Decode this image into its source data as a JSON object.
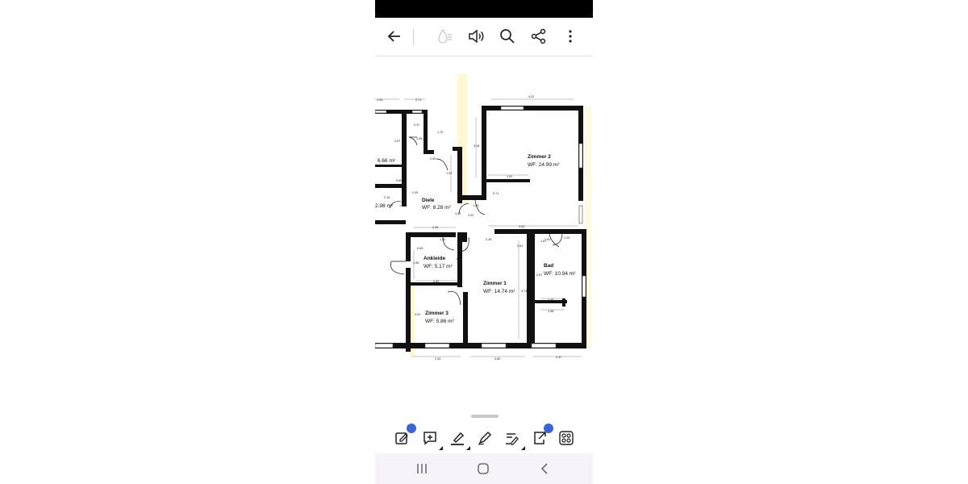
{
  "toolbar": {
    "icons": [
      "back-arrow-icon",
      "water-drop-icon",
      "speaker-icon",
      "search-icon",
      "share-icon",
      "more-vert-icon"
    ]
  },
  "floorplan": {
    "rooms": [
      {
        "name": "Zimmer 2",
        "area": "WF: 24.99 m²"
      },
      {
        "name": "Diele",
        "area": "WF: 8.28 m²"
      },
      {
        "name": "Ankleide",
        "area": "WF: 5.17 m²"
      },
      {
        "name": "Zimmer 1",
        "area": "WF: 14.74 m²"
      },
      {
        "name": "Bad",
        "area": "WF: 10.94 m²"
      },
      {
        "name": "Zimmer 3",
        "area": "WF: 5.86 m²"
      }
    ],
    "partial_rooms": [
      {
        "area": "6.66 m²"
      },
      {
        "area": "2.98 m²"
      }
    ],
    "dimensions": [
      "4.22",
      "1.94",
      "0.71",
      "0.37",
      "1.70",
      "2.67",
      "1.45",
      "WC",
      "2.05",
      "1.87",
      "0.69",
      "2.16",
      "2.39",
      "1.25",
      "1.52",
      "0.71",
      "3.18",
      "1.29",
      "1.02",
      "1.27",
      "2.30",
      "1.50",
      "2.36",
      "0.61",
      "0.69",
      "1.00",
      "1.67",
      "1.55",
      "2.67",
      "1.45",
      "1.56",
      "4.74",
      "2.32",
      "1.36",
      "2.51",
      "2.33",
      "3.80",
      "2.37",
      "2.91",
      "3.52"
    ]
  },
  "bottom_toolbar": {
    "icons": [
      "edit-document-icon",
      "add-comment-icon",
      "highlighter-icon",
      "pen-icon",
      "draw-sign-icon",
      "export-icon",
      "grid-apps-icon"
    ]
  },
  "navbar": {
    "icons": [
      "recent-apps-icon",
      "home-icon",
      "back-icon"
    ]
  }
}
